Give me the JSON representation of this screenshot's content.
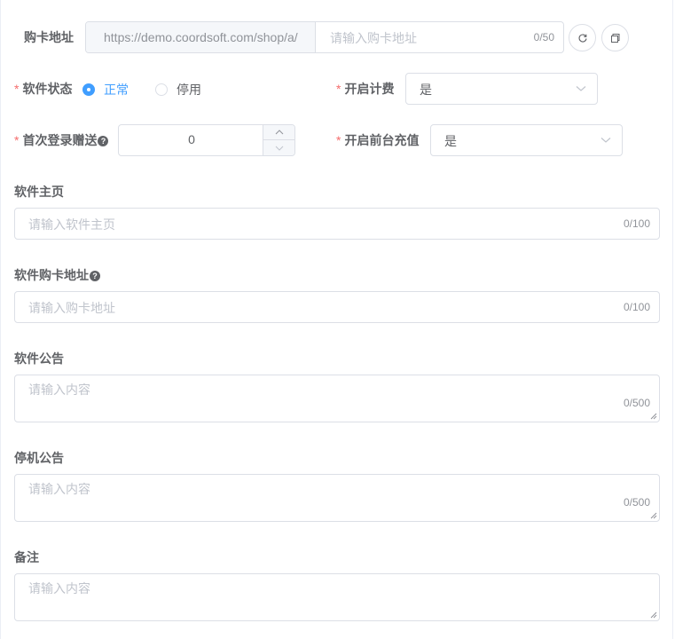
{
  "buy_card": {
    "label": "购卡地址",
    "prefix": "https://demo.coordsoft.com/shop/a/",
    "placeholder": "请输入购卡地址",
    "count": "0/50"
  },
  "software_status": {
    "label": "软件状态",
    "option_normal": "正常",
    "option_disabled": "停用",
    "selected": "正常"
  },
  "billing": {
    "label": "开启计费",
    "value": "是"
  },
  "first_login_gift": {
    "label": "首次登录赠送",
    "value": "0"
  },
  "frontend_recharge": {
    "label": "开启前台充值",
    "value": "是"
  },
  "homepage": {
    "label": "软件主页",
    "placeholder": "请输入软件主页",
    "count": "0/100"
  },
  "software_buy_card": {
    "label": "软件购卡地址",
    "placeholder": "请输入购卡地址",
    "count": "0/100"
  },
  "announcement": {
    "label": "软件公告",
    "placeholder": "请输入内容",
    "count": "0/500"
  },
  "shutdown_notice": {
    "label": "停机公告",
    "placeholder": "请输入内容",
    "count": "0/500"
  },
  "remark": {
    "label": "备注",
    "placeholder": "请输入内容"
  },
  "colors": {
    "primary": "#409eff",
    "required": "#f56c6c",
    "border": "#dcdfe6",
    "placeholder": "#c0c4cc"
  }
}
